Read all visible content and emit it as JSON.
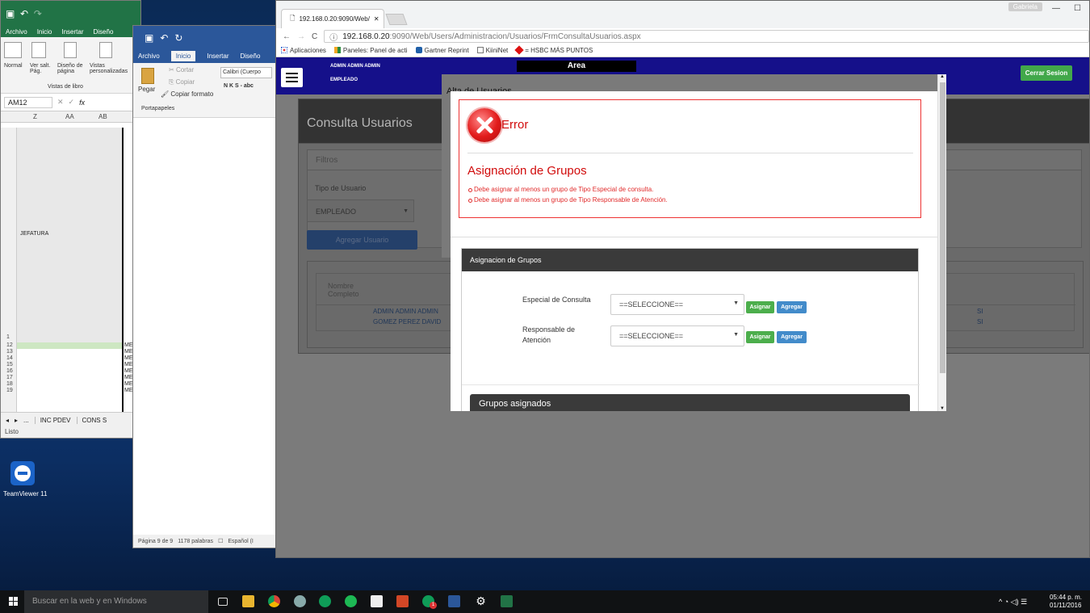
{
  "excel": {
    "tabs": [
      "Archivo",
      "Inicio",
      "Insertar",
      "Diseño"
    ],
    "view_buttons": [
      "Normal",
      "Ver salt. Pág.",
      "Diseño de página",
      "Vistas personalizadas"
    ],
    "group_label": "Vistas de libro",
    "name_box": "AM12",
    "columns": [
      "Z",
      "AA",
      "AB"
    ],
    "cell_text": "JEFATURA",
    "row_numbers": [
      "1",
      "12",
      "13",
      "14",
      "15",
      "16",
      "17",
      "18",
      "19"
    ],
    "row_cell": "ME",
    "sheet_nav": "...",
    "sheets": [
      "INC PDEV",
      "CONS S"
    ],
    "status": "Listo"
  },
  "word": {
    "tabs": [
      "Archivo",
      "Inicio",
      "Insertar",
      "Diseño"
    ],
    "clipboard": {
      "paste": "Pegar",
      "cut": "Cortar",
      "copy": "Copiar",
      "format": "Copiar formato",
      "group": "Portapapeles"
    },
    "font_name": "Calibri (Cuerpo",
    "font_buttons": "N K S - abc",
    "status": {
      "page": "Página 9 de 9",
      "words": "1178 palabras",
      "lang": "Español (I"
    }
  },
  "chrome": {
    "tab_title": "192.168.0.20:9090/Web/",
    "user": "Gabriela",
    "url_host": "192.168.0.20",
    "url_rest": ":9090/Web/Users/Administracion/Usuarios/FrmConsultaUsuarios.aspx",
    "bookmarks": [
      "Aplicaciones",
      "Paneles: Panel de acti",
      "Gartner Reprint",
      "KiiniNet",
      "= HSBC MÁS PUNTOS"
    ]
  },
  "page": {
    "user_name": "ADMIN ADMIN ADMIN",
    "user_role": "EMPLEADO",
    "area": "Area",
    "logout": "Cerrar Sesion",
    "title": "Consulta Usuarios",
    "filters_title": "Filtros",
    "user_type_label": "Tipo de Usuario",
    "user_type_value": "EMPLEADO",
    "add_user": "Agregar Usuario",
    "col_name": "Nombre Completo",
    "rows": [
      {
        "name": "ADMIN ADMIN ADMIN",
        "flag": "SI"
      },
      {
        "name": "GOMEZ PEREZ DAVID",
        "flag": "SI"
      }
    ]
  },
  "modal": {
    "title": "Alta de Usuarios",
    "error": {
      "title": "Error",
      "heading": "Asignación de Grupos",
      "items": [
        "Debe asignar al menos un grupo de Tipo Especial de consulta.",
        "Debe asignar al menos un grupo de Tipo Responsable de Atención."
      ]
    },
    "groups_panel": "Asignacion de Grupos",
    "fields": [
      {
        "label": "Especial de Consulta",
        "value": "==SELECCIONE=="
      },
      {
        "label": "Responsable de Atención",
        "value": "==SELECCIONE=="
      }
    ],
    "assign": "Asignar",
    "add": "Agregar",
    "assigned_title": "Grupos asignados"
  },
  "desktop": {
    "icon_label": "TeamViewer 11"
  },
  "taskbar": {
    "search": "Buscar en la web y en Windows",
    "time": "05:44 p. m.",
    "date": "01/11/2016",
    "badge": "1"
  }
}
